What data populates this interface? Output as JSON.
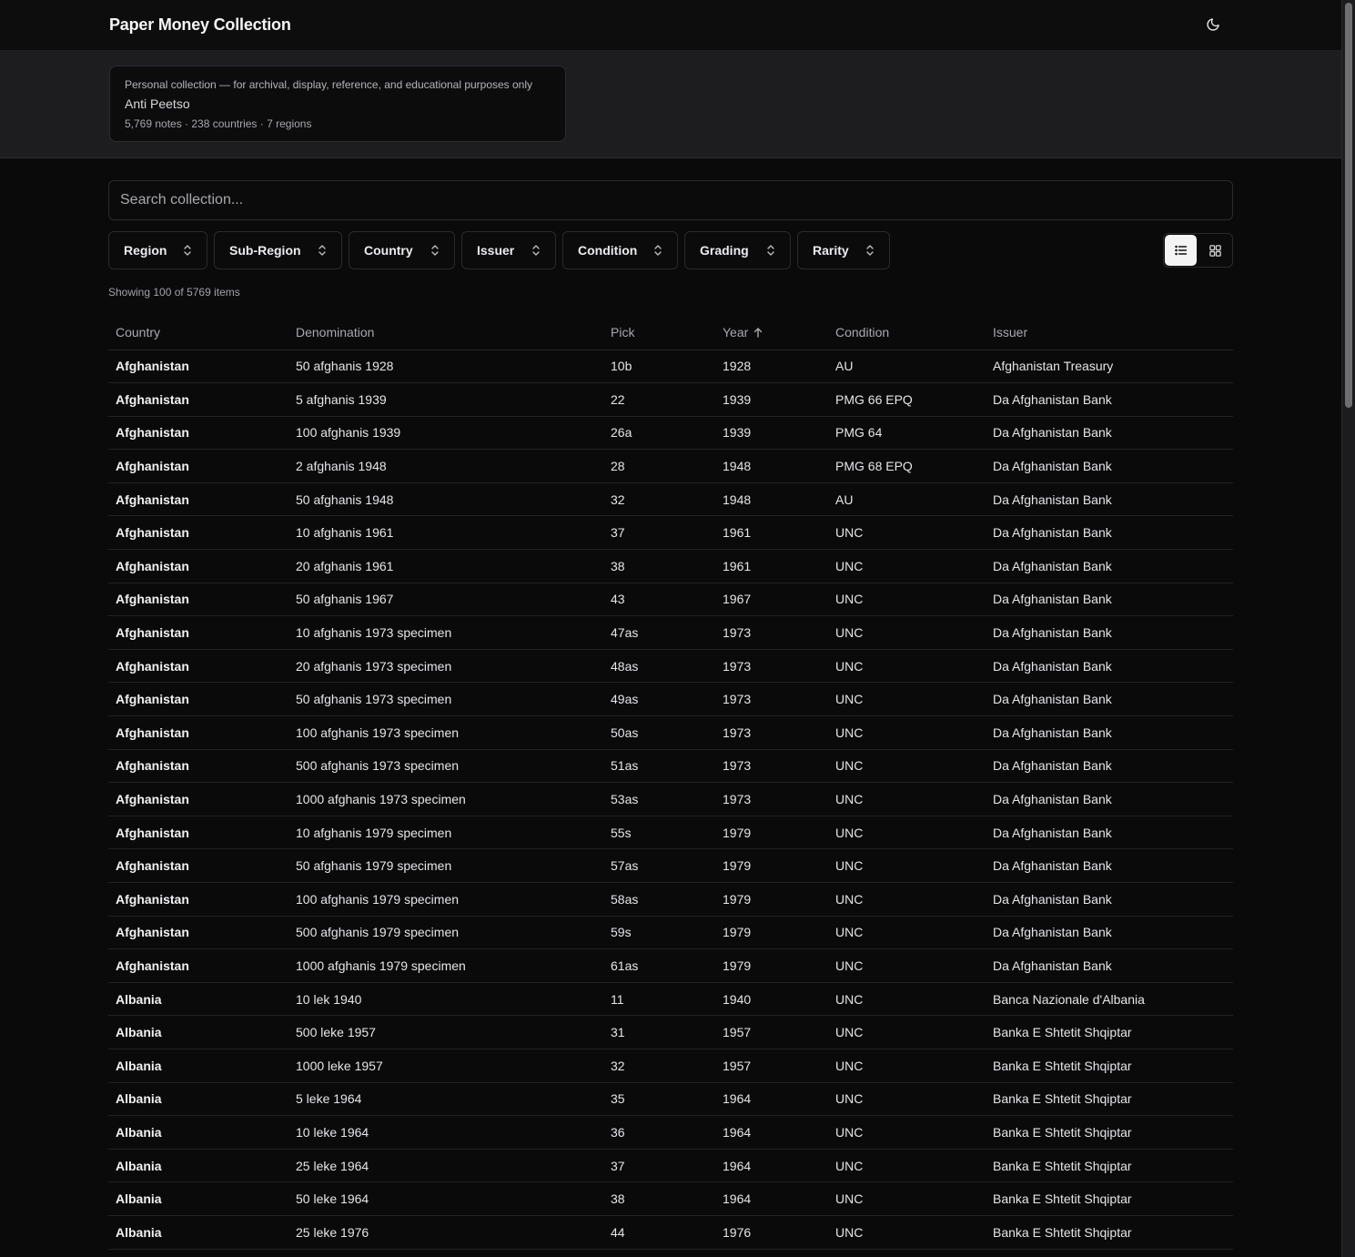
{
  "app": {
    "title": "Paper Money Collection",
    "theme_icon": "moon-icon"
  },
  "info": {
    "subtitle": "Personal collection — for archival, display, reference, and educational purposes only",
    "owner": "Anti Peetso",
    "stats": "5,769 notes · 238 countries · 7 regions"
  },
  "search": {
    "placeholder": "Search collection...",
    "value": ""
  },
  "filters": [
    {
      "label": "Region"
    },
    {
      "label": "Sub-Region"
    },
    {
      "label": "Country"
    },
    {
      "label": "Issuer"
    },
    {
      "label": "Condition"
    },
    {
      "label": "Grading"
    },
    {
      "label": "Rarity"
    }
  ],
  "view": {
    "selected": "list",
    "options": [
      "list-icon",
      "grid-icon"
    ]
  },
  "count": "Showing 100 of 5769 items",
  "table": {
    "headers": [
      "Country",
      "Denomination",
      "Pick",
      "Year",
      "Condition",
      "Issuer"
    ],
    "sorted_by": "Year",
    "sort_icon": "arrow-up-icon",
    "rows": [
      [
        "Afghanistan",
        "50 afghanis 1928",
        "10b",
        "1928",
        "AU",
        "Afghanistan Treasury"
      ],
      [
        "Afghanistan",
        "5 afghanis 1939",
        "22",
        "1939",
        "PMG 66 EPQ",
        "Da Afghanistan Bank"
      ],
      [
        "Afghanistan",
        "100 afghanis 1939",
        "26a",
        "1939",
        "PMG 64",
        "Da Afghanistan Bank"
      ],
      [
        "Afghanistan",
        "2 afghanis 1948",
        "28",
        "1948",
        "PMG 68 EPQ",
        "Da Afghanistan Bank"
      ],
      [
        "Afghanistan",
        "50 afghanis 1948",
        "32",
        "1948",
        "AU",
        "Da Afghanistan Bank"
      ],
      [
        "Afghanistan",
        "10 afghanis 1961",
        "37",
        "1961",
        "UNC",
        "Da Afghanistan Bank"
      ],
      [
        "Afghanistan",
        "20 afghanis 1961",
        "38",
        "1961",
        "UNC",
        "Da Afghanistan Bank"
      ],
      [
        "Afghanistan",
        "50 afghanis 1967",
        "43",
        "1967",
        "UNC",
        "Da Afghanistan Bank"
      ],
      [
        "Afghanistan",
        "10 afghanis 1973 specimen",
        "47as",
        "1973",
        "UNC",
        "Da Afghanistan Bank"
      ],
      [
        "Afghanistan",
        "20 afghanis 1973 specimen",
        "48as",
        "1973",
        "UNC",
        "Da Afghanistan Bank"
      ],
      [
        "Afghanistan",
        "50 afghanis 1973 specimen",
        "49as",
        "1973",
        "UNC",
        "Da Afghanistan Bank"
      ],
      [
        "Afghanistan",
        "100 afghanis 1973 specimen",
        "50as",
        "1973",
        "UNC",
        "Da Afghanistan Bank"
      ],
      [
        "Afghanistan",
        "500 afghanis 1973 specimen",
        "51as",
        "1973",
        "UNC",
        "Da Afghanistan Bank"
      ],
      [
        "Afghanistan",
        "1000 afghanis 1973 specimen",
        "53as",
        "1973",
        "UNC",
        "Da Afghanistan Bank"
      ],
      [
        "Afghanistan",
        "10 afghanis 1979 specimen",
        "55s",
        "1979",
        "UNC",
        "Da Afghanistan Bank"
      ],
      [
        "Afghanistan",
        "50 afghanis 1979 specimen",
        "57as",
        "1979",
        "UNC",
        "Da Afghanistan Bank"
      ],
      [
        "Afghanistan",
        "100 afghanis 1979 specimen",
        "58as",
        "1979",
        "UNC",
        "Da Afghanistan Bank"
      ],
      [
        "Afghanistan",
        "500 afghanis 1979 specimen",
        "59s",
        "1979",
        "UNC",
        "Da Afghanistan Bank"
      ],
      [
        "Afghanistan",
        "1000 afghanis 1979 specimen",
        "61as",
        "1979",
        "UNC",
        "Da Afghanistan Bank"
      ],
      [
        "Albania",
        "10 lek 1940",
        "11",
        "1940",
        "UNC",
        "Banca Nazionale d'Albania"
      ],
      [
        "Albania",
        "500 leke 1957",
        "31",
        "1957",
        "UNC",
        "Banka E Shtetit Shqiptar"
      ],
      [
        "Albania",
        "1000 leke 1957",
        "32",
        "1957",
        "UNC",
        "Banka E Shtetit Shqiptar"
      ],
      [
        "Albania",
        "5 leke 1964",
        "35",
        "1964",
        "UNC",
        "Banka E Shtetit Shqiptar"
      ],
      [
        "Albania",
        "10 leke 1964",
        "36",
        "1964",
        "UNC",
        "Banka E Shtetit Shqiptar"
      ],
      [
        "Albania",
        "25 leke 1964",
        "37",
        "1964",
        "UNC",
        "Banka E Shtetit Shqiptar"
      ],
      [
        "Albania",
        "50 leke 1964",
        "38",
        "1964",
        "UNC",
        "Banka E Shtetit Shqiptar"
      ],
      [
        "Albania",
        "25 leke 1976",
        "44",
        "1976",
        "UNC",
        "Banka E Shtetit Shqiptar"
      ]
    ]
  }
}
